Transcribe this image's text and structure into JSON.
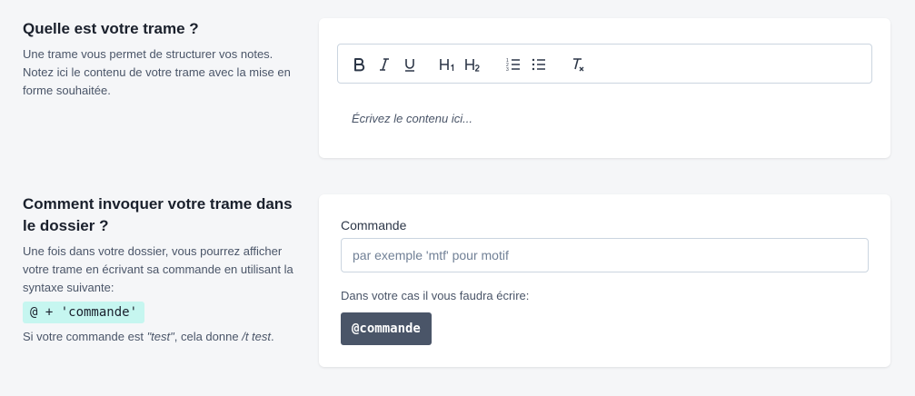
{
  "section_template": {
    "title": "Quelle est votre trame ?",
    "description": "Une trame vous permet de structurer vos notes. Notez ici le contenu de votre trame avec la mise en forme souhaitée.",
    "editor": {
      "placeholder": "Écrivez le contenu ici...",
      "toolbar": [
        {
          "name": "bold",
          "icon": "bold-icon",
          "label": "B"
        },
        {
          "name": "italic",
          "icon": "italic-icon",
          "label": "I"
        },
        {
          "name": "underline",
          "icon": "underline-icon",
          "label": "U"
        },
        {
          "name": "heading1",
          "icon": "heading-1-icon",
          "label": "H1"
        },
        {
          "name": "heading2",
          "icon": "heading-2-icon",
          "label": "H2"
        },
        {
          "name": "ordered-list",
          "icon": "ordered-list-icon"
        },
        {
          "name": "bullet-list",
          "icon": "bullet-list-icon"
        },
        {
          "name": "clear-format",
          "icon": "clear-format-icon",
          "label": "Tx"
        }
      ]
    }
  },
  "section_command": {
    "title": "Comment invoquer votre trame dans le dossier ?",
    "description": "Une fois dans votre dossier, vous pourrez afficher votre trame en écrivant sa commande en utilisant la syntaxe suivante:",
    "syntax": "@ + 'commande'",
    "example_prefix": "Si votre commande est ",
    "example_value": "\"test\"",
    "example_middle": ", cela donne ",
    "example_result": "/t test",
    "example_suffix": ".",
    "field_label": "Commande",
    "field_value": "",
    "field_placeholder": "par exemple 'mtf' pour motif",
    "hint": "Dans votre cas il vous faudra écrire:",
    "result_badge": "@commande"
  },
  "colors": {
    "background": "#f5f6f8",
    "card": "#ffffff",
    "badge_bg": "#4a5568",
    "syntax_bg": "#c6f6f0"
  }
}
